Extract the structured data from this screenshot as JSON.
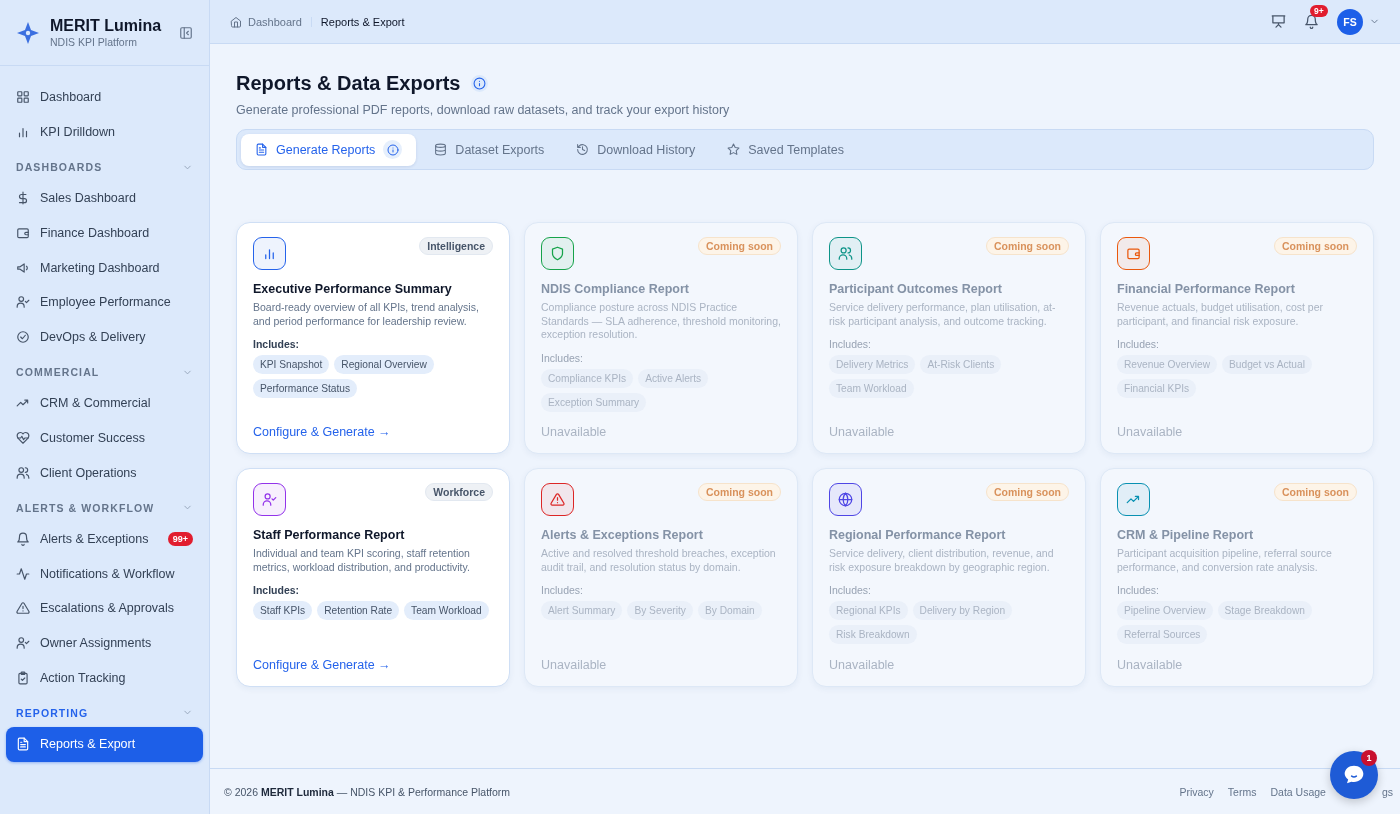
{
  "sidebar": {
    "brand": {
      "name": "MERIT Lumina",
      "subtitle": "NDIS KPI Platform"
    },
    "top_items": [
      {
        "label": "Dashboard",
        "selected": false
      },
      {
        "label": "KPI Drilldown",
        "selected": false
      }
    ],
    "sections": [
      {
        "title": "DASHBOARDS",
        "selected": false,
        "items": [
          {
            "label": "Sales Dashboard",
            "selected": false
          },
          {
            "label": "Finance Dashboard",
            "selected": false
          },
          {
            "label": "Marketing Dashboard",
            "selected": false
          },
          {
            "label": "Employee Performance",
            "selected": false
          },
          {
            "label": "DevOps & Delivery",
            "selected": false
          }
        ]
      },
      {
        "title": "COMMERCIAL",
        "selected": false,
        "items": [
          {
            "label": "CRM & Commercial",
            "selected": false
          },
          {
            "label": "Customer Success",
            "selected": false
          },
          {
            "label": "Client Operations",
            "selected": false
          }
        ]
      },
      {
        "title": "ALERTS & WORKFLOW",
        "selected": false,
        "items": [
          {
            "label": "Alerts & Exceptions",
            "selected": false,
            "badge": "99+"
          },
          {
            "label": "Notifications & Workflow",
            "selected": false
          },
          {
            "label": "Escalations & Approvals",
            "selected": false
          },
          {
            "label": "Owner Assignments",
            "selected": false
          },
          {
            "label": "Action Tracking",
            "selected": false
          }
        ]
      },
      {
        "title": "REPORTING",
        "selected": true,
        "items": [
          {
            "label": "Reports & Export",
            "selected": true
          }
        ]
      }
    ]
  },
  "header": {
    "breadcrumbs": [
      "Dashboard",
      "Reports & Export"
    ],
    "notification_badge": "9+",
    "avatar": "FS"
  },
  "page": {
    "title": "Reports & Data Exports",
    "subtitle": "Generate professional PDF reports, download raw datasets, and track your export history"
  },
  "tabs": [
    {
      "label": "Generate Reports",
      "selected": true
    },
    {
      "label": "Dataset Exports",
      "selected": false
    },
    {
      "label": "Download History",
      "selected": false
    },
    {
      "label": "Saved Templates",
      "selected": false
    }
  ],
  "cards": [
    {
      "color": "#2563eb",
      "badge": "Intelligence",
      "available": true,
      "title": "Executive Performance Summary",
      "description": "Board-ready overview of all KPIs, trend analysis, and period performance for leadership review.",
      "includes_label": "Includes:",
      "chips": [
        "KPI Snapshot",
        "Regional Overview",
        "Performance Status"
      ],
      "action": "Configure & Generate →"
    },
    {
      "color": "#16a34a",
      "badge": "Coming soon",
      "available": false,
      "title": "NDIS Compliance Report",
      "description": "Compliance posture across NDIS Practice Standards — SLA adherence, threshold monitoring, exception resolution.",
      "includes_label": "Includes:",
      "chips": [
        "Compliance KPIs",
        "Active Alerts",
        "Exception Summary"
      ],
      "action": "Unavailable"
    },
    {
      "color": "#0d9488",
      "badge": "Coming soon",
      "available": false,
      "title": "Participant Outcomes Report",
      "description": "Service delivery performance, plan utilisation, at-risk participant analysis, and outcome tracking.",
      "includes_label": "Includes:",
      "chips": [
        "Delivery Metrics",
        "At-Risk Clients",
        "Team Workload"
      ],
      "action": "Unavailable"
    },
    {
      "color": "#ea580c",
      "badge": "Coming soon",
      "available": false,
      "title": "Financial Performance Report",
      "description": "Revenue actuals, budget utilisation, cost per participant, and financial risk exposure.",
      "includes_label": "Includes:",
      "chips": [
        "Revenue Overview",
        "Budget vs Actual",
        "Financial KPIs"
      ],
      "action": "Unavailable"
    },
    {
      "color": "#9333ea",
      "badge": "Workforce",
      "available": true,
      "title": "Staff Performance Report",
      "description": "Individual and team KPI scoring, staff retention metrics, workload distribution, and productivity.",
      "includes_label": "Includes:",
      "chips": [
        "Staff KPIs",
        "Retention Rate",
        "Team Workload"
      ],
      "action": "Configure & Generate →"
    },
    {
      "color": "#dc2626",
      "badge": "Coming soon",
      "available": false,
      "title": "Alerts & Exceptions Report",
      "description": "Active and resolved threshold breaches, exception audit trail, and resolution status by domain.",
      "includes_label": "Includes:",
      "chips": [
        "Alert Summary",
        "By Severity",
        "By Domain"
      ],
      "action": "Unavailable"
    },
    {
      "color": "#4f46e5",
      "badge": "Coming soon",
      "available": false,
      "title": "Regional Performance Report",
      "description": "Service delivery, client distribution, revenue, and risk exposure breakdown by geographic region.",
      "includes_label": "Includes:",
      "chips": [
        "Regional KPIs",
        "Delivery by Region",
        "Risk Breakdown"
      ],
      "action": "Unavailable"
    },
    {
      "color": "#0891b2",
      "badge": "Coming soon",
      "available": false,
      "title": "CRM & Pipeline Report",
      "description": "Participant acquisition pipeline, referral source performance, and conversion rate analysis.",
      "includes_label": "Includes:",
      "chips": [
        "Pipeline Overview",
        "Stage Breakdown",
        "Referral Sources"
      ],
      "action": "Unavailable"
    }
  ],
  "footer": {
    "year": "© 2026",
    "brand": "MERIT Lumina",
    "tagline": "— NDIS KPI & Performance Platform",
    "links": [
      "Privacy",
      "Terms",
      "Data Usage",
      "gs"
    ]
  },
  "chat": {
    "badge": "1"
  }
}
